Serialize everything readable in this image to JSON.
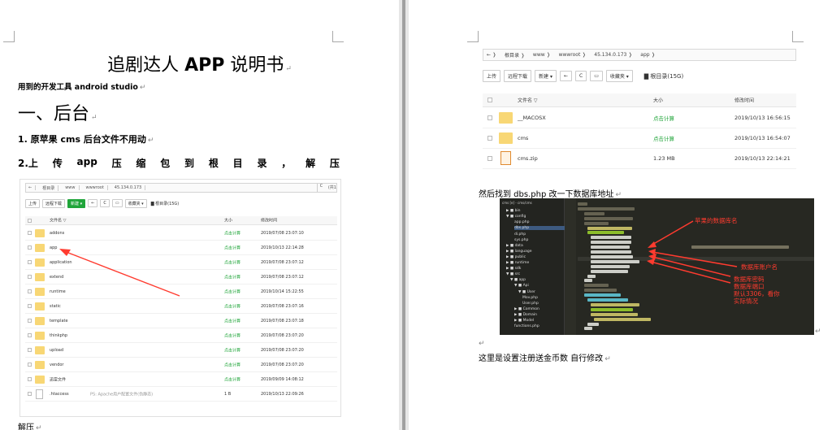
{
  "left_page": {
    "title_pre": "追剧达人 ",
    "title_app": "APP",
    "title_post": " 说明书",
    "tools_line": "用到的开发工具 android studio",
    "heading1": "一、后台",
    "item1": "1. 原苹果 cms 后台文件不用动",
    "item2_words": [
      "2.上",
      "传",
      "app",
      "压",
      "缩",
      "包",
      "到",
      "根",
      "目",
      "录",
      "，",
      "解",
      "压"
    ],
    "caption": "解压",
    "screenshot": {
      "breadcrumb": [
        "根目录",
        "www",
        "wwwroot",
        "45.134.0.173"
      ],
      "breadcrumb_right": "(共1",
      "toolbar": [
        "上传",
        "远程下载",
        "新建 ▾",
        "←",
        "C",
        "▭",
        "收藏夹 ▾"
      ],
      "root_label": "根目录(15G)",
      "headers": [
        "文件名 ▽",
        "大小",
        "修改时间"
      ],
      "rows": [
        {
          "name": "addons",
          "size": "点击计算",
          "time": "2019/07/08 23:07:10",
          "type": "folder"
        },
        {
          "name": "app",
          "size": "点击计算",
          "time": "2019/10/13 22:14:28",
          "type": "folder"
        },
        {
          "name": "application",
          "size": "点击计算",
          "time": "2019/07/08 23:07:12",
          "type": "folder"
        },
        {
          "name": "extend",
          "size": "点击计算",
          "time": "2019/07/08 23:07:12",
          "type": "folder"
        },
        {
          "name": "runtime",
          "size": "点击计算",
          "time": "2019/10/14 15:22:55",
          "type": "folder"
        },
        {
          "name": "static",
          "size": "点击计算",
          "time": "2019/07/08 23:07:16",
          "type": "folder"
        },
        {
          "name": "template",
          "size": "点击计算",
          "time": "2019/07/08 23:07:18",
          "type": "folder"
        },
        {
          "name": "thinkphp",
          "size": "点击计算",
          "time": "2019/07/08 23:07:20",
          "type": "folder"
        },
        {
          "name": "upload",
          "size": "点击计算",
          "time": "2019/07/08 23:07:20",
          "type": "folder"
        },
        {
          "name": "vendor",
          "size": "点击计算",
          "time": "2019/07/08 23:07:20",
          "type": "folder"
        },
        {
          "name": "迅雷文件",
          "size": "点击计算",
          "time": "2019/09/09 14:08:12",
          "type": "folder"
        },
        {
          "name": ".htaccess",
          "note": "PS: Apache用户配置文件(伪静态)",
          "size": "1 B",
          "time": "2019/10/13 22:09:26",
          "type": "file"
        }
      ]
    }
  },
  "right_page": {
    "screenshot": {
      "breadcrumb": [
        "←",
        "根目录",
        "www",
        "wwwroot",
        "45.134.0.173",
        "app"
      ],
      "toolbar": [
        "上传",
        "远程下载",
        "新建 ▾",
        "←",
        "C",
        "▭",
        "收藏夹 ▾"
      ],
      "root_label": "根目录(15G)",
      "headers": [
        "文件名 ▽",
        "大小",
        "修改时间"
      ],
      "rows": [
        {
          "name": "__MACOSX",
          "size": "点击计算",
          "time": "2019/10/13 16:56:15",
          "type": "folder"
        },
        {
          "name": "cms",
          "size": "点击计算",
          "time": "2019/10/13 16:54:07",
          "type": "folder"
        },
        {
          "name": "cms.zip",
          "size": "1.23 MB",
          "time": "2019/10/13 22:14:21",
          "type": "zip"
        }
      ]
    },
    "dbs_line": "然后找到 dbs.php    改一下数据库地址",
    "code_shot": {
      "tree": [
        {
          "label": "cms [e] - cms/cms",
          "indent": 0
        },
        {
          "label": "▶ ■ bin",
          "indent": 1
        },
        {
          "label": "▼ ■ config",
          "indent": 1
        },
        {
          "label": "app.php",
          "indent": 3
        },
        {
          "label": "dbs.php",
          "indent": 3
        },
        {
          "label": "di.php",
          "indent": 3
        },
        {
          "label": "sys.php",
          "indent": 3
        },
        {
          "label": "▶ ■ data",
          "indent": 1
        },
        {
          "label": "▶ ■ language",
          "indent": 1
        },
        {
          "label": "▶ ■ public",
          "indent": 1
        },
        {
          "label": "▶ ■ runtime",
          "indent": 1
        },
        {
          "label": "▶ ■ sdk",
          "indent": 1
        },
        {
          "label": "▼ ■ src",
          "indent": 1
        },
        {
          "label": "▼ ■ app",
          "indent": 2
        },
        {
          "label": "▼ ■ Api",
          "indent": 3
        },
        {
          "label": "▼ ■ User",
          "indent": 4
        },
        {
          "label": "Mov.php",
          "indent": 5
        },
        {
          "label": "User.php",
          "indent": 5
        },
        {
          "label": "▶ ■ Common",
          "indent": 3
        },
        {
          "label": "▶ ■ Domain",
          "indent": 3
        },
        {
          "label": "▶ ■ Model",
          "indent": 3
        },
        {
          "label": "functions.php",
          "indent": 3
        }
      ],
      "annotations": {
        "db_name": "苹果的数据库名",
        "db_user": "数据库账户名",
        "db_pass": "数据库密码",
        "db_port": "数据库端口",
        "db_default": "默认3306，看你",
        "db_actual": "实际情况"
      }
    },
    "register_line": "这里是设置注册送金币数  自行修改"
  },
  "colors": {
    "accent_green": "#20a53a",
    "folder_yellow": "#f8d775",
    "annotation_red": "#ff3b2f",
    "editor_bg": "#272822"
  }
}
